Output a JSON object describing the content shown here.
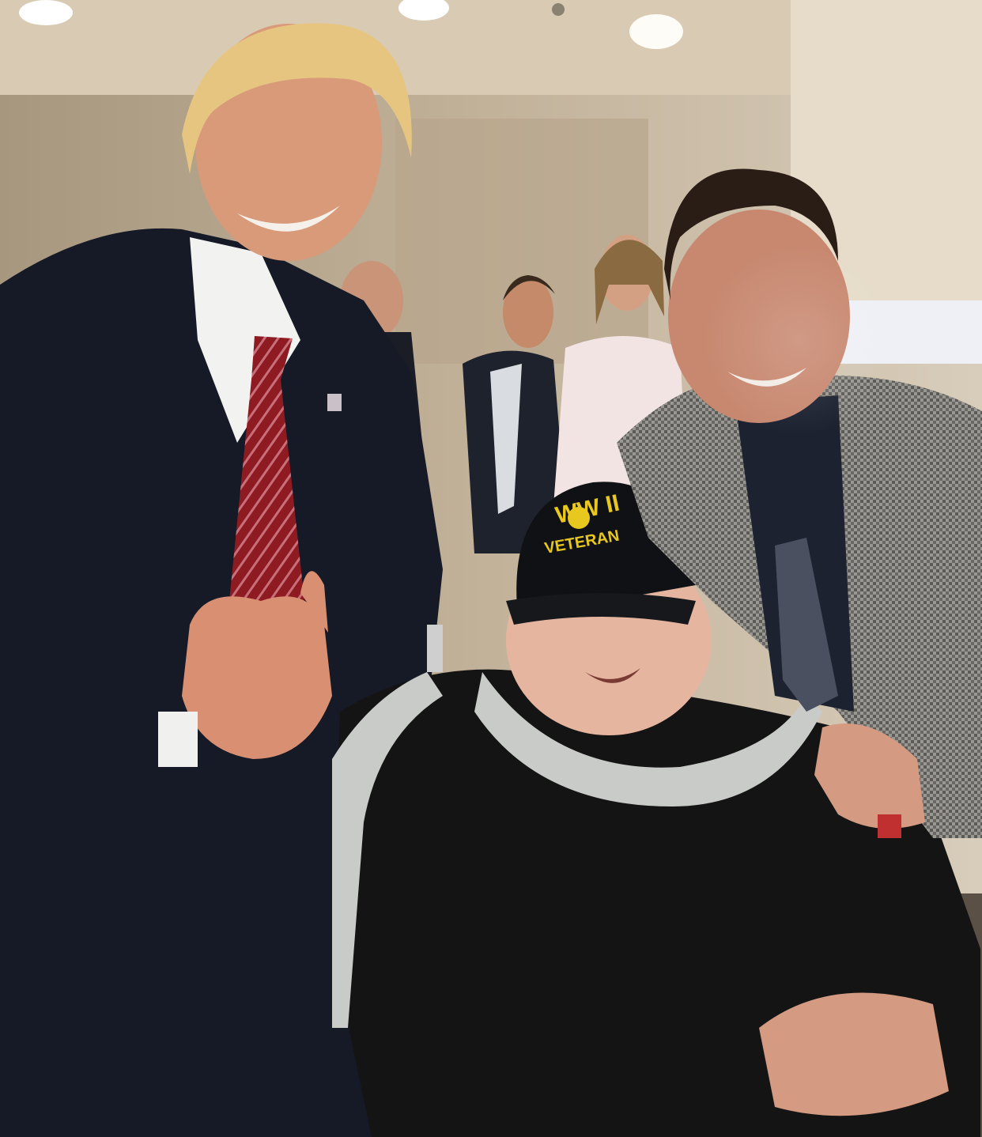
{
  "photo": {
    "colors": {
      "wall": "#b8a78f",
      "ceiling": "#d9cbb3",
      "carpet": "#5a5045",
      "suit_dark": "#161a26",
      "tie_red": "#8e1a22",
      "blanket": "#141414",
      "fleece": "#c9cbc8",
      "hat_black": "#101114",
      "hat_gold": "#e8c81e",
      "houndstooth": "#8a8884",
      "skin": "#d99a7a"
    },
    "hat": {
      "line1": "WW II",
      "line2": "VETERAN"
    }
  }
}
